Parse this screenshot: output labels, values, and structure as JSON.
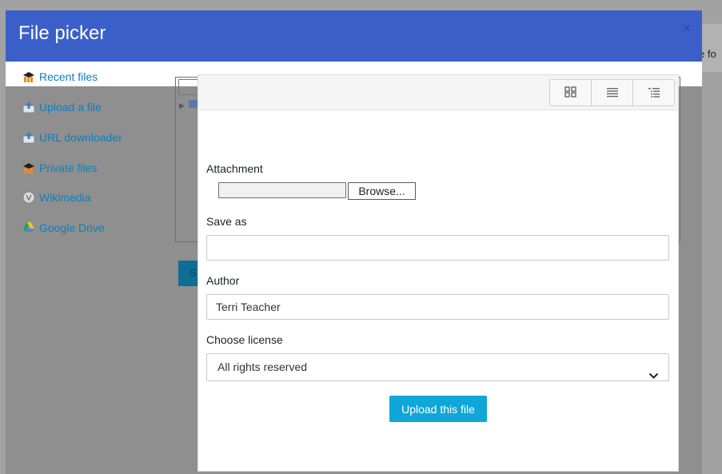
{
  "background": {
    "right_text": "e fo"
  },
  "dialog": {
    "title": "File picker",
    "close_symbol": "×",
    "header_color": "#3a5fc8"
  },
  "repositories": [
    {
      "label": "Recent files",
      "icon": "recent-files-icon"
    },
    {
      "label": "Upload a file",
      "icon": "upload-icon"
    },
    {
      "label": "URL downloader",
      "icon": "url-downloader-icon"
    },
    {
      "label": "Private files",
      "icon": "private-files-icon"
    },
    {
      "label": "Wikimedia",
      "icon": "wikimedia-icon"
    },
    {
      "label": "Google Drive",
      "icon": "google-drive-icon"
    }
  ],
  "behind_button_text": "S",
  "toolbar": {
    "views": [
      {
        "name": "icons-view",
        "icon": "grid-icon"
      },
      {
        "name": "list-view",
        "icon": "list-icon"
      },
      {
        "name": "tree-view",
        "icon": "tree-icon"
      }
    ]
  },
  "upload_form": {
    "attachment_label": "Attachment",
    "browse_label": "Browse...",
    "save_as_label": "Save as",
    "save_as_value": "",
    "author_label": "Author",
    "author_value": "Terri Teacher",
    "license_label": "Choose license",
    "license_value": "All rights reserved",
    "submit_label": "Upload this file",
    "accent_color": "#0fa6d8",
    "link_color": "#0b80c0"
  }
}
